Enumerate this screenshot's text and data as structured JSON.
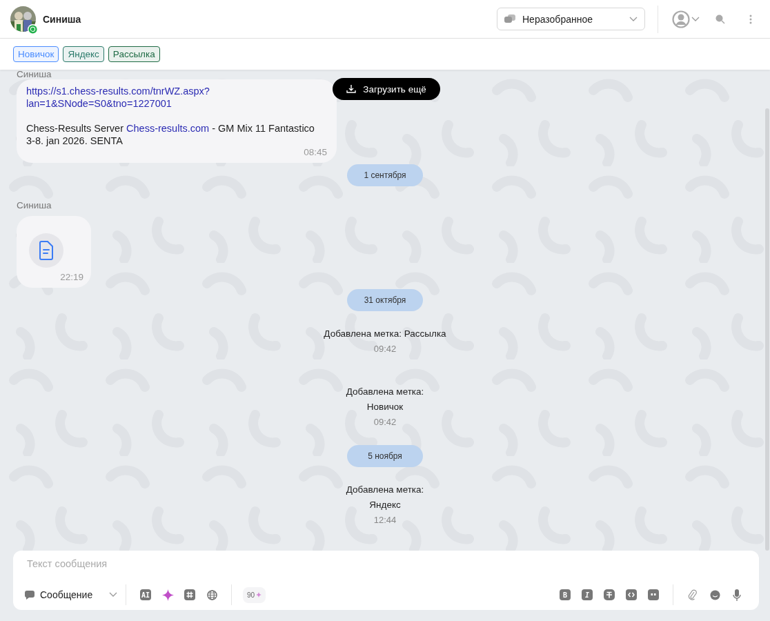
{
  "header": {
    "contact_name": "Синиша",
    "folder_select": {
      "value": "Неразобранное"
    }
  },
  "tags": [
    {
      "label": "Новичок",
      "color": "#4a8cff"
    },
    {
      "label": "Яндекс",
      "color": "#2a7a6a"
    },
    {
      "label": "Рассылка",
      "color": "#1f6b45"
    }
  ],
  "load_more": {
    "label": "Загрузить ещё"
  },
  "feed": [
    {
      "kind": "message",
      "sender": "Синиша",
      "link_lines": [
        "https://s1.chess-results.com/tnrWZ.aspx?",
        "lan=1&SNode=S0&tno=1227001"
      ],
      "parts": [
        {
          "kind": "text",
          "text": "Chess-Results Server "
        },
        {
          "kind": "link",
          "text": "Chess-results.com"
        },
        {
          "kind": "text",
          "text": " - GM Mix 11 Fantastico 3-8. jan 2026. SENTA"
        }
      ],
      "time": "08:45"
    },
    {
      "kind": "date",
      "text": "1 сентября"
    },
    {
      "kind": "file",
      "sender": "Синиша",
      "time": "22:19"
    },
    {
      "kind": "date",
      "text": "31 октября"
    },
    {
      "kind": "event",
      "lines": [
        "Добавлена метка: Рассылка"
      ],
      "time": "09:42"
    },
    {
      "kind": "event",
      "lines": [
        "Добавлена метка:",
        "Новичок"
      ],
      "time": "09:42"
    },
    {
      "kind": "date",
      "text": "5 ноября"
    },
    {
      "kind": "event",
      "lines": [
        "Добавлена метка:",
        "Яндекс"
      ],
      "time": "12:44"
    }
  ],
  "composer": {
    "placeholder": "Текст сообщения",
    "type_select": {
      "value": "Сообщение"
    },
    "ai_label": "AI",
    "credits": "90",
    "format_buttons": [
      {
        "kind": "bold",
        "label": "B"
      },
      {
        "kind": "italic",
        "label": "I"
      },
      {
        "kind": "strike"
      },
      {
        "kind": "code"
      },
      {
        "kind": "quote"
      }
    ]
  }
}
